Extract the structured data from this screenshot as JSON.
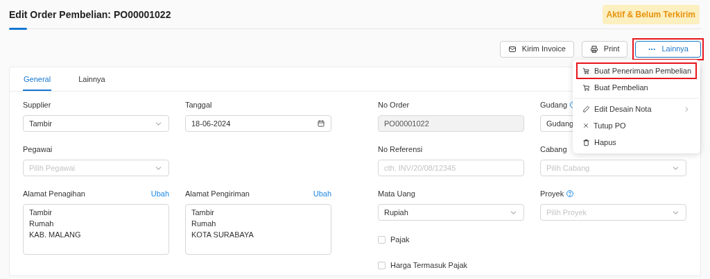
{
  "header": {
    "title": "Edit Order Pembelian: PO00001022",
    "status_badge": "Aktif & Belum Terkirim"
  },
  "toolbar": [
    {
      "kind": "mail",
      "label": "Kirim Invoice"
    },
    {
      "kind": "print",
      "label": "Print"
    },
    {
      "kind": "more",
      "label": "Lainnya",
      "highlighted": true
    }
  ],
  "dropdown_menu": [
    {
      "kind": "receive",
      "label": "Buat Penerimaan Pembelian",
      "highlighted": true
    },
    {
      "kind": "cart",
      "label": "Buat Pembelian",
      "divider_after": true
    },
    {
      "kind": "edit",
      "label": "Edit Desain Nota",
      "submenu": true
    },
    {
      "kind": "close",
      "label": "Tutup PO"
    },
    {
      "kind": "delete",
      "label": "Hapus"
    }
  ],
  "tabs": [
    {
      "label": "General",
      "selected": true
    },
    {
      "label": "Lainnya",
      "selected": false
    }
  ],
  "form": {
    "left_rows": [
      [
        {
          "kind": "select",
          "label": "Supplier",
          "value": "Tambir"
        },
        {
          "kind": "date",
          "label": "Tanggal",
          "value": "18-06-2024"
        }
      ],
      [
        {
          "kind": "select",
          "label": "Pegawai",
          "placeholder": "Pilih Pegawai"
        }
      ],
      [
        {
          "kind": "address",
          "label": "Alamat Penagihan",
          "action": "Ubah",
          "lines": [
            "Tambir",
            "Rumah",
            "KAB. MALANG"
          ]
        },
        {
          "kind": "address",
          "label": "Alamat Pengiriman",
          "action": "Ubah",
          "lines": [
            "Tambir",
            "Rumah",
            "KOTA SURABAYA"
          ]
        }
      ]
    ],
    "right_rows": [
      [
        {
          "kind": "text",
          "label": "No Order",
          "value": "PO00001022",
          "disabled": true
        },
        {
          "kind": "select",
          "label": "Gudang",
          "value": "Gudang",
          "help": true
        }
      ],
      [
        {
          "kind": "text",
          "label": "No Referensi",
          "placeholder": "cth. INV/20/08/12345"
        },
        {
          "kind": "select",
          "label": "Cabang",
          "placeholder": "Pilih Cabang"
        }
      ],
      [
        {
          "kind": "select",
          "label": "Mata Uang",
          "value": "Rupiah"
        },
        {
          "kind": "select",
          "label": "Proyek",
          "placeholder": "Pilih Proyek",
          "help": true
        }
      ],
      [
        {
          "kind": "checkbox",
          "label": "Pajak",
          "checked": false
        }
      ],
      [
        {
          "kind": "checkbox",
          "label": "Harga Termasuk Pajak",
          "checked": false
        }
      ]
    ]
  }
}
